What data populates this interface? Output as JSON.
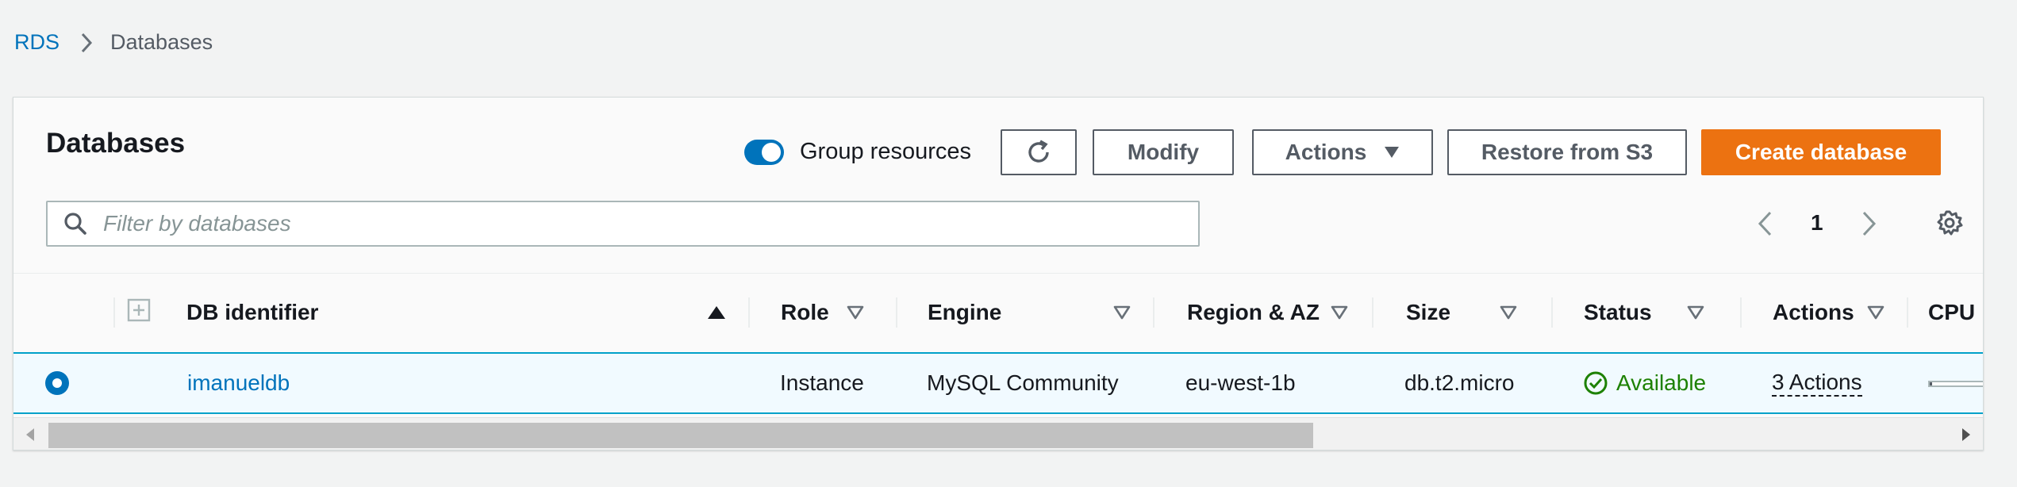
{
  "breadcrumb": {
    "root": "RDS",
    "current": "Databases"
  },
  "panel": {
    "title": "Databases",
    "group_toggle": {
      "label": "Group resources",
      "on": true
    },
    "buttons": {
      "refresh_icon": "refresh-icon",
      "modify": "Modify",
      "actions": "Actions",
      "restore": "Restore from S3",
      "create": "Create database"
    },
    "search": {
      "placeholder": "Filter by databases",
      "value": ""
    },
    "pagination": {
      "page": "1"
    }
  },
  "table": {
    "columns": {
      "db_identifier": "DB identifier",
      "role": "Role",
      "engine": "Engine",
      "region": "Region & AZ",
      "size": "Size",
      "status": "Status",
      "actions": "Actions",
      "cpu": "CPU"
    },
    "rows": [
      {
        "selected": true,
        "db_identifier": "imanueldb",
        "role": "Instance",
        "engine": "MySQL Community",
        "region": "eu-west-1b",
        "size": "db.t2.micro",
        "status": "Available",
        "actions": "3 Actions"
      }
    ]
  },
  "colors": {
    "link": "#0073bb",
    "primary_button": "#ec7211",
    "status_available": "#1d8102",
    "selected_row_bg": "#f1faff",
    "selected_row_border": "#00a1c9"
  }
}
